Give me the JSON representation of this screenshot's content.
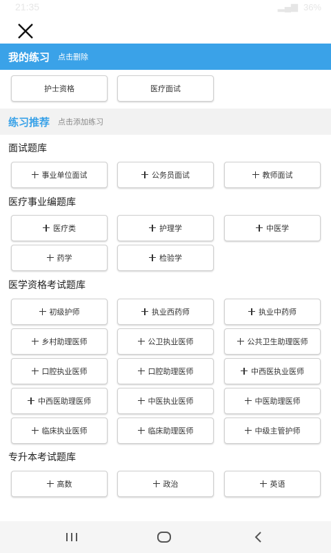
{
  "status": {
    "time": "21:35",
    "battery": "36%"
  },
  "header": {
    "close_icon": "close-icon"
  },
  "my_practice": {
    "title": "我的练习",
    "hint": "点击删除",
    "items": [
      "护士资格",
      "医疗面试"
    ]
  },
  "recommend": {
    "title": "练习推荐",
    "hint": "点击添加练习"
  },
  "groups": [
    {
      "title": "面试题库",
      "items": [
        "事业单位面试",
        "公务员面试",
        "教师面试"
      ]
    },
    {
      "title": "医疗事业编题库",
      "items": [
        "医疗类",
        "护理学",
        "中医学",
        "药学",
        "检验学"
      ]
    },
    {
      "title": "医学资格考试题库",
      "items": [
        "初级护师",
        "执业西药师",
        "执业中药师",
        "乡村助理医师",
        "公卫执业医师",
        "公共卫生助理医师",
        "口腔执业医师",
        "口腔助理医师",
        "中西医执业医师",
        "中西医助理医师",
        "中医执业医师",
        "中医助理医师",
        "临床执业医师",
        "临床助理医师",
        "中级主管护师"
      ]
    },
    {
      "title": "专升本考试题库",
      "items": [
        "高数",
        "政治",
        "英语"
      ]
    }
  ],
  "colors": {
    "accent": "#3aa2e8",
    "grey_bar": "#f2f2f2"
  }
}
